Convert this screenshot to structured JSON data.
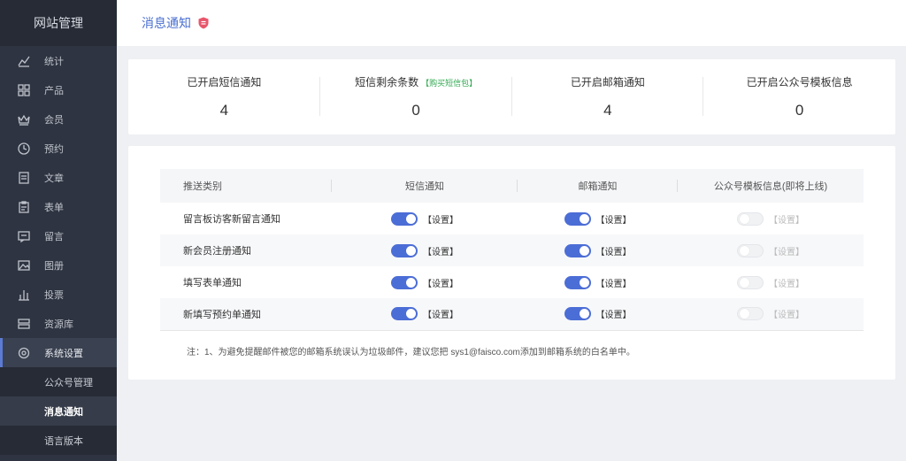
{
  "sidebar": {
    "brand": "网站管理",
    "items": [
      {
        "label": "统计",
        "icon": "chart-line-icon"
      },
      {
        "label": "产品",
        "icon": "grid-icon"
      },
      {
        "label": "会员",
        "icon": "crown-icon"
      },
      {
        "label": "预约",
        "icon": "clock-icon"
      },
      {
        "label": "文章",
        "icon": "document-icon"
      },
      {
        "label": "表单",
        "icon": "clipboard-icon"
      },
      {
        "label": "留言",
        "icon": "message-icon"
      },
      {
        "label": "图册",
        "icon": "image-icon"
      },
      {
        "label": "投票",
        "icon": "bar-chart-icon"
      },
      {
        "label": "资源库",
        "icon": "database-icon"
      },
      {
        "label": "系统设置",
        "icon": "settings-icon"
      }
    ],
    "sub_items": [
      "公众号管理",
      "消息通知",
      "语言版本"
    ]
  },
  "header": {
    "title": "消息通知"
  },
  "stats": [
    {
      "label": "已开启短信通知",
      "value": "4"
    },
    {
      "label": "短信剩余条数",
      "buy": "【购买短信包】",
      "value": "0"
    },
    {
      "label": "已开启邮箱通知",
      "value": "4"
    },
    {
      "label": "已开启公众号模板信息",
      "value": "0"
    }
  ],
  "table": {
    "headers": [
      "推送类别",
      "短信通知",
      "邮箱通知",
      "公众号模板信息(即将上线)"
    ],
    "setting_label": "【设置】",
    "rows": [
      {
        "name": "留言板访客新留言通知",
        "sms": true,
        "email": true,
        "wechat": false
      },
      {
        "name": "新会员注册通知",
        "sms": true,
        "email": true,
        "wechat": false
      },
      {
        "name": "填写表单通知",
        "sms": true,
        "email": true,
        "wechat": false
      },
      {
        "name": "新填写预约单通知",
        "sms": true,
        "email": true,
        "wechat": false
      }
    ]
  },
  "note": "注：1、为避免提醒邮件被您的邮箱系统误认为垃圾邮件，建议您把 sys1@faisco.com添加到邮箱系统的白名单中。",
  "colors": {
    "accent": "#4b6dd6",
    "sidebar": "#2e3441",
    "buy_link": "#2fa84f"
  }
}
